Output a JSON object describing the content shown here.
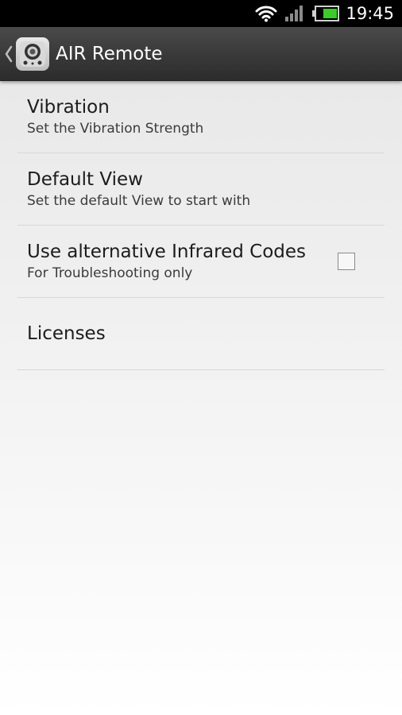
{
  "status_bar": {
    "time": "19:45",
    "icons": [
      "wifi-icon",
      "signal-icon",
      "battery-icon"
    ],
    "battery_color": "#3ccc2a"
  },
  "action_bar": {
    "title": "AIR Remote",
    "icons": [
      "back-chevron-icon",
      "speaker-app-icon"
    ]
  },
  "settings": {
    "items": [
      {
        "title": "Vibration",
        "summary": "Set the Vibration Strength"
      },
      {
        "title": "Default View",
        "summary": "Set the default View to start with"
      },
      {
        "title": "Use alternative Infrared Codes",
        "summary": "For Troubleshooting only",
        "checked": false
      },
      {
        "title": "Licenses"
      }
    ]
  },
  "colors": {
    "status_bar_bg": "#000000",
    "action_bar_bg": "#3a3a3a",
    "divider": "#d7d7d7",
    "text_primary": "#1c1c1c",
    "text_secondary": "#3b3b3b"
  }
}
